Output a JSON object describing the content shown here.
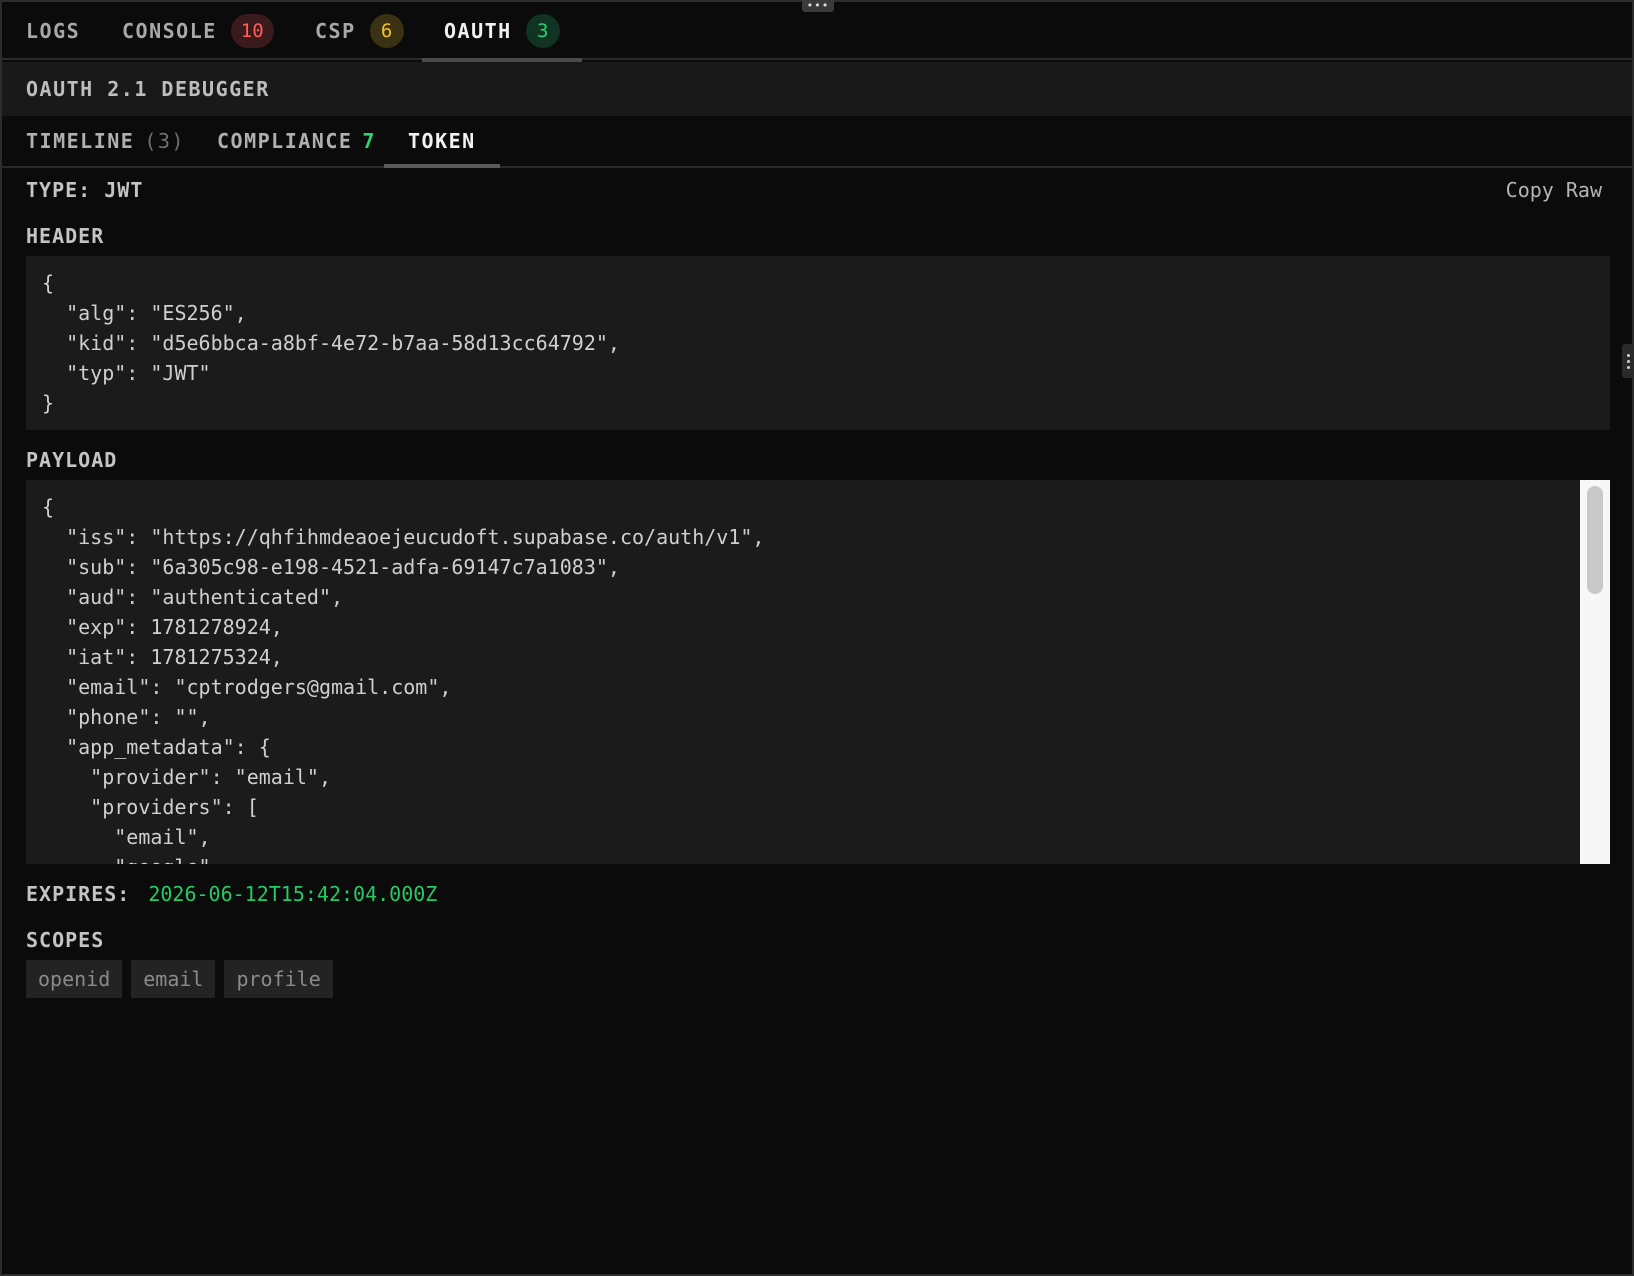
{
  "main_tabs": [
    {
      "label": "LOGS"
    },
    {
      "label": "CONSOLE",
      "badge": "10",
      "badge_color": "#ff5c5c"
    },
    {
      "label": "CSP",
      "badge": "6",
      "badge_color": "#f3c12b"
    },
    {
      "label": "OAUTH",
      "badge": "3",
      "badge_color": "#2ed16f",
      "active": true
    }
  ],
  "panel_title": "OAUTH 2.1 DEBUGGER",
  "sub_tabs": [
    {
      "label": "TIMELINE",
      "count": "(3)"
    },
    {
      "label": "COMPLIANCE",
      "count": "7"
    },
    {
      "label": "TOKEN",
      "active": true
    }
  ],
  "token": {
    "type_label": "TYPE: JWT",
    "copy_raw": "Copy Raw",
    "header_label": "HEADER",
    "header_json": "{\n  \"alg\": \"ES256\",\n  \"kid\": \"d5e6bbca-a8bf-4e72-b7aa-58d13cc64792\",\n  \"typ\": \"JWT\"\n}",
    "payload_label": "PAYLOAD",
    "payload_json": "{\n  \"iss\": \"https://qhfihmdeaoejeucudoft.supabase.co/auth/v1\",\n  \"sub\": \"6a305c98-e198-4521-adfa-69147c7a1083\",\n  \"aud\": \"authenticated\",\n  \"exp\": 1781278924,\n  \"iat\": 1781275324,\n  \"email\": \"cptrodgers@gmail.com\",\n  \"phone\": \"\",\n  \"app_metadata\": {\n    \"provider\": \"email\",\n    \"providers\": [\n      \"email\",\n      \"google\"",
    "expires_label": "EXPIRES:",
    "expires_value": "2026-06-12T15:42:04.000Z",
    "scopes_label": "SCOPES",
    "scopes": [
      "openid",
      "email",
      "profile"
    ]
  },
  "colors": {
    "background": "#0b0b0b",
    "accent_green": "#2ed16f",
    "accent_red": "#ff5c5c",
    "accent_yellow": "#f3c12b"
  }
}
